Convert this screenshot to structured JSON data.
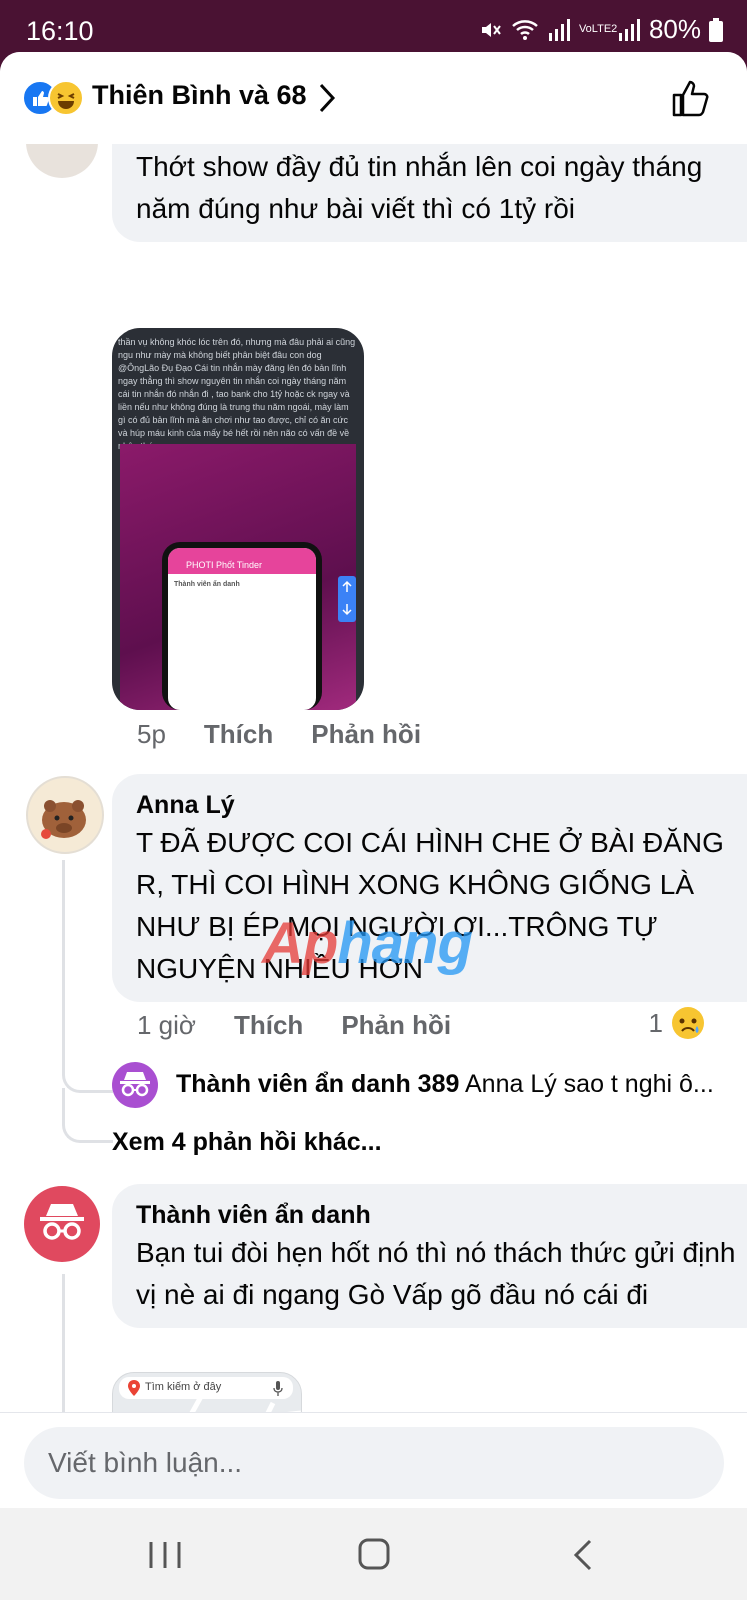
{
  "status_bar": {
    "time": "16:10",
    "battery": "80%",
    "network": "VoLTE2"
  },
  "header": {
    "reactors": "Thiên Bình và 68"
  },
  "comments": [
    {
      "text": "Thớt show đầy đủ tin nhắn lên coi ngày tháng năm đúng như bài viết thì có 1tỷ rồi",
      "time": "5p",
      "like_label": "Thích",
      "reply_label": "Phản hồi",
      "image_text": "thần vụ không khóc lóc trên đó, nhưng mà đâu phải ai cũng ngu như mày mà không biết phân biệt đâu con dog @ÔngLão Đụ Đạo Cái tin nhắn mày đăng lên đó bản lĩnh ngay thẳng thì show nguyên tin nhắn coi ngày tháng năm cái tin nhắn đó nhắn đi , tao bank cho 1tỷ hoặc ck ngay và liền nếu như không đúng là trung thu năm ngoái, mày làm gì có đủ bản lĩnh mà ăn chơi như tao được, chỉ có ăn cức và húp máu kinh của mấy bé hết rồi nên não có vấn đề về nhận thức",
      "image_app": "PHOTI Phốt Tinder",
      "image_poster": "Thành viên ẩn danh"
    },
    {
      "author": "Anna Lý",
      "text": "T ĐÃ ĐƯỢC COI CÁI HÌNH CHE Ở BÀI ĐĂNG R, THÌ COI HÌNH XONG KHÔNG GIỐNG LÀ NHƯ BỊ ÉP MỌI NGƯỜI ƠI...TRÔNG TỰ NGUYỆN NHIỀU HƠN",
      "time": "1 giờ",
      "like_label": "Thích",
      "reply_label": "Phản hồi",
      "reaction_count": "1",
      "reply": {
        "author": "Thành viên ẩn danh 389",
        "text": "Anna Lý sao t nghi ô..."
      },
      "more_replies": "Xem 4 phản hồi khác..."
    },
    {
      "author": "Thành viên ẩn danh",
      "text": "Bạn tui đòi hẹn hốt nó thì nó thách thức gửi định vị nè ai đi ngang Gò Vấp gõ đầu nó cái đi",
      "map_search": "Tìm kiếm ở đây"
    }
  ],
  "watermark": {
    "part1": "Ap",
    "part2": "hang"
  },
  "composer": {
    "placeholder": "Viết bình luận..."
  },
  "colors": {
    "status_bg": "#4a1233",
    "bubble": "#f0f2f5",
    "muted": "#65676b",
    "like_blue": "#1877f2"
  }
}
